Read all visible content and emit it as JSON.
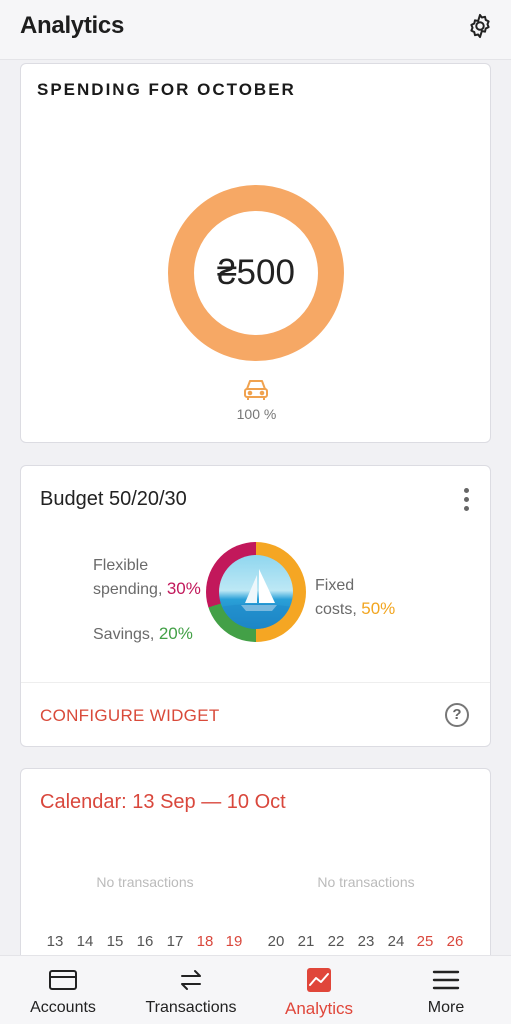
{
  "header": {
    "title": "Analytics"
  },
  "spending": {
    "title": "SPENDING FOR OCTOBER",
    "amount": "₴500",
    "category_icon": "car-icon",
    "category_percent": "100 %",
    "ring_color": "#f6a865"
  },
  "budget": {
    "title": "Budget 50/20/30",
    "flexible_line1": "Flexible",
    "flexible_line2": "spending,",
    "flexible_value": "30%",
    "savings_label": "Savings,",
    "savings_value": "20%",
    "fixed_line1": "Fixed",
    "fixed_line2": "costs,",
    "fixed_value": "50%",
    "configure_label": "CONFIGURE WIDGET",
    "help_label": "?",
    "colors": {
      "flexible": "#c2185b",
      "savings": "#43a047",
      "fixed": "#f5a623"
    }
  },
  "calendar": {
    "title": "Calendar: 13 Sep — 10 Oct",
    "weeks": [
      {
        "empty_label": "No transactions",
        "days": [
          "13",
          "14",
          "15",
          "16",
          "17",
          "18",
          "19"
        ]
      },
      {
        "empty_label": "No transactions",
        "days": [
          "20",
          "21",
          "22",
          "23",
          "24",
          "25",
          "26"
        ]
      }
    ]
  },
  "nav": {
    "items": [
      {
        "label": "Accounts",
        "icon": "wallet-icon"
      },
      {
        "label": "Transactions",
        "icon": "transfer-arrows-icon"
      },
      {
        "label": "Analytics",
        "icon": "chart-icon"
      },
      {
        "label": "More",
        "icon": "menu-icon"
      }
    ],
    "active_color": "#e0463a"
  }
}
